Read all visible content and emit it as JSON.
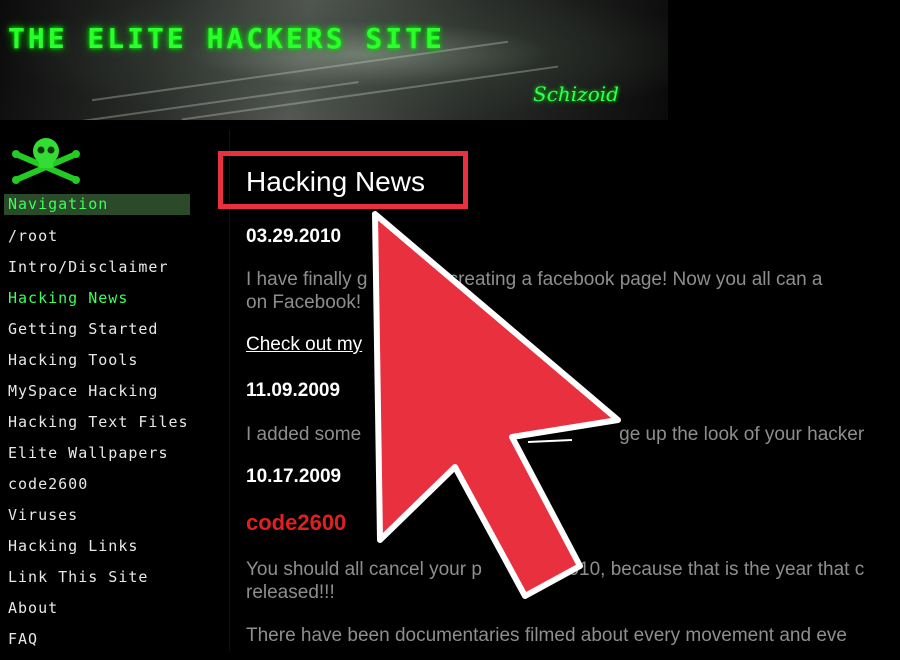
{
  "header": {
    "site_title": "THE ELITE HACKERS SITE",
    "signature": "Schizoid"
  },
  "sidebar": {
    "nav_header": "Navigation",
    "items": [
      {
        "label": "/root"
      },
      {
        "label": "Intro/Disclaimer"
      },
      {
        "label": "Hacking News"
      },
      {
        "label": "Getting Started"
      },
      {
        "label": "Hacking Tools"
      },
      {
        "label": "MySpace Hacking"
      },
      {
        "label": "Hacking Text Files"
      },
      {
        "label": "Elite Wallpapers"
      },
      {
        "label": "code2600"
      },
      {
        "label": "Viruses"
      },
      {
        "label": "Hacking Links"
      },
      {
        "label": "Link This Site"
      },
      {
        "label": "About"
      },
      {
        "label": "FAQ"
      }
    ],
    "active_item": "Hacking News"
  },
  "main": {
    "title": "Hacking News",
    "entries": {
      "date1": "03.29.2010",
      "para1_line1_a": "I have finally g",
      "para1_line1_b": "to creating a facebook page! Now you all can a",
      "para1_line2": "on Facebook!",
      "link1": "Check out my",
      "date2": "11.09.2009",
      "para2_a": "I added some",
      "para2_b": "ge up the look of your hacker",
      "date3": "10.17.2009",
      "heading3": "code2600",
      "para3_line1_a": "You should all cancel your p",
      "para3_line1_b": "2010, because that is the year that c",
      "para3_line2": "released!!!",
      "para4": "There have been documentaries filmed about every movement and eve"
    }
  },
  "colors": {
    "accent_green": "#3bff5a",
    "highlight_red": "#e8303f",
    "body_grey": "#8e8e8e",
    "heading_red": "#e02020"
  }
}
